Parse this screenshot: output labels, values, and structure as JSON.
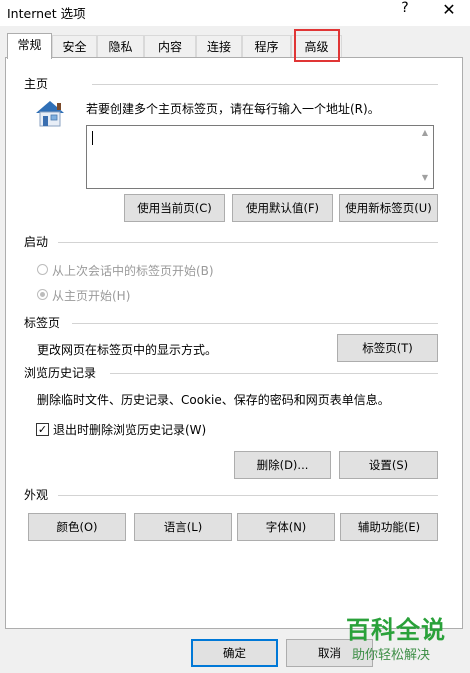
{
  "window": {
    "title": "Internet 选项",
    "help": "?",
    "close": "✕"
  },
  "tabs": [
    "常规",
    "安全",
    "隐私",
    "内容",
    "连接",
    "程序",
    "高级"
  ],
  "home": {
    "section": "主页",
    "instruction": "若要创建多个主页标签页，请在每行输入一个地址(R)。",
    "value": "",
    "buttons": [
      "使用当前页(C)",
      "使用默认值(F)",
      "使用新标签页(U)"
    ]
  },
  "startup": {
    "section": "启动",
    "options": [
      {
        "label": "从上次会话中的标签页开始(B)",
        "checked": false
      },
      {
        "label": "从主页开始(H)",
        "checked": true
      }
    ]
  },
  "tabs_section": {
    "section": "标签页",
    "description": "更改网页在标签页中的显示方式。",
    "button": "标签页(T)"
  },
  "history": {
    "section": "浏览历史记录",
    "description": "删除临时文件、历史记录、Cookie、保存的密码和网页表单信息。",
    "checkbox_label": "退出时删除浏览历史记录(W)",
    "checkbox_checked": true,
    "delete_button": "删除(D)...",
    "settings_button": "设置(S)"
  },
  "appearance": {
    "section": "外观",
    "buttons": [
      "颜色(O)",
      "语言(L)",
      "字体(N)",
      "辅助功能(E)"
    ]
  },
  "footer": {
    "ok": "确定",
    "cancel": "取消"
  },
  "watermark": {
    "logo": "百科全说",
    "tagline": "助你轻松解决"
  }
}
